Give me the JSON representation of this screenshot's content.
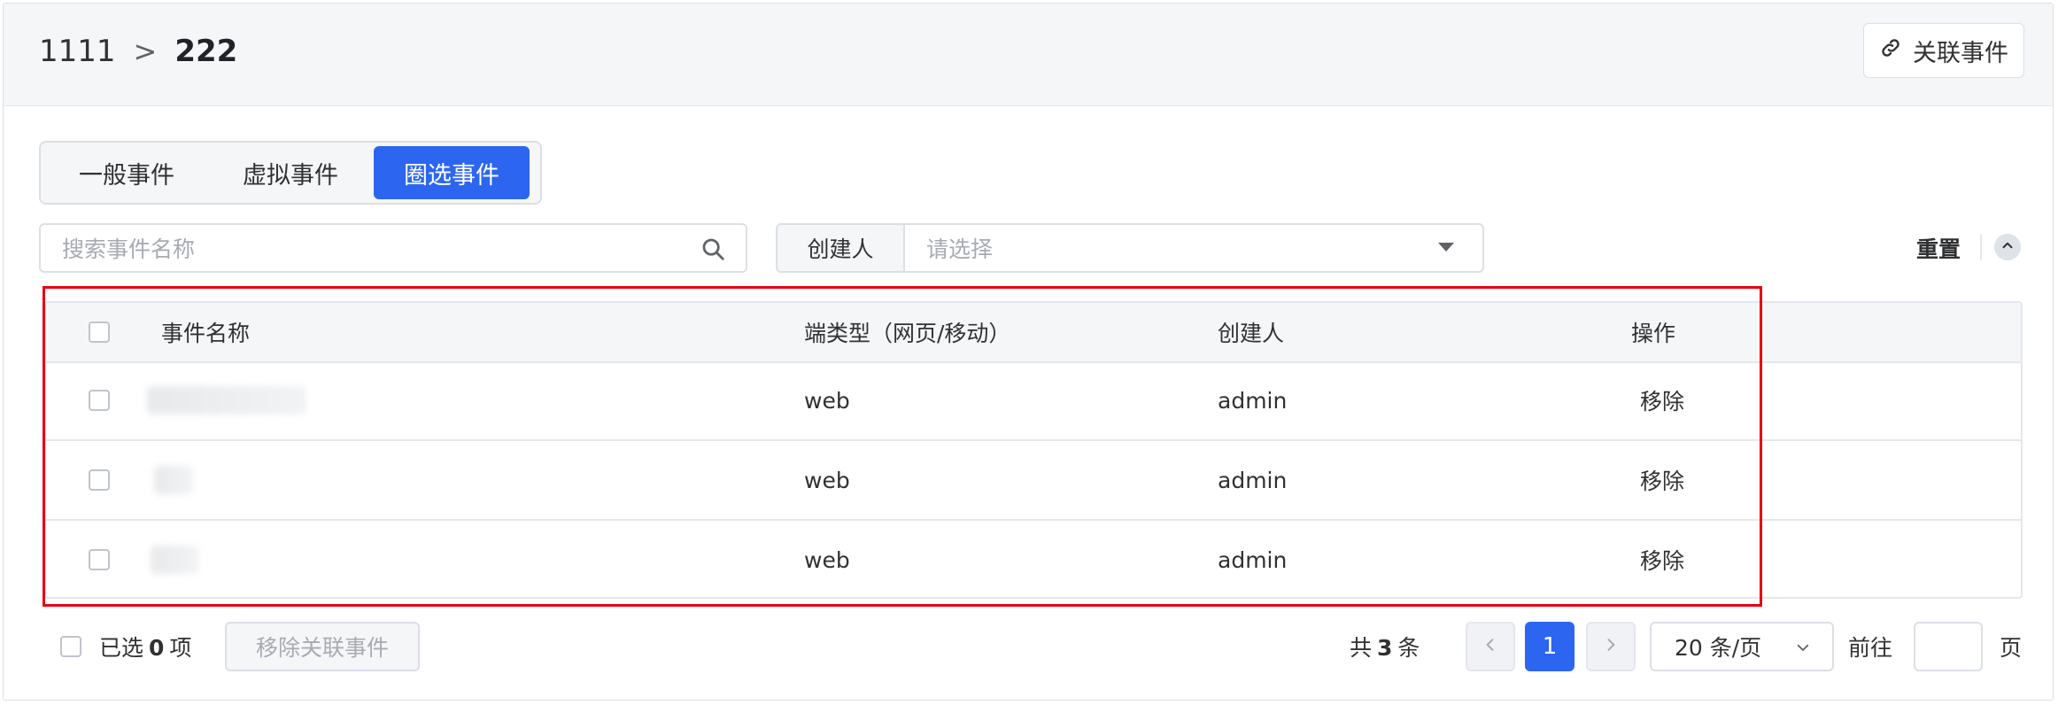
{
  "breadcrumb": {
    "parent": "1111",
    "separator": ">",
    "current": "222"
  },
  "header": {
    "link_event_button": "关联事件"
  },
  "tabs": [
    {
      "label": "一般事件",
      "active": false
    },
    {
      "label": "虚拟事件",
      "active": false
    },
    {
      "label": "圈选事件",
      "active": true
    }
  ],
  "search": {
    "placeholder": "搜索事件名称",
    "value": ""
  },
  "filter": {
    "label": "创建人",
    "placeholder": "请选择"
  },
  "toolbar": {
    "reset_label": "重置"
  },
  "table": {
    "columns": [
      "事件名称",
      "端类型（网页/移动）",
      "创建人",
      "操作"
    ],
    "rows": [
      {
        "name": "",
        "type": "web",
        "creator": "admin",
        "action": "移除"
      },
      {
        "name": "",
        "type": "web",
        "creator": "admin",
        "action": "移除"
      },
      {
        "name": "",
        "type": "web",
        "creator": "admin",
        "action": "移除"
      }
    ]
  },
  "footer": {
    "selected_prefix": "已选",
    "selected_count": "0",
    "selected_suffix": "项",
    "remove_linked_button": "移除关联事件",
    "total_prefix": "共",
    "total_count": "3",
    "total_suffix": "条",
    "current_page": "1",
    "page_size": "20 条/页",
    "goto_label": "前往",
    "goto_value": "",
    "goto_unit": "页"
  },
  "colors": {
    "primary": "#2c66f0",
    "highlight_border": "#e60012"
  }
}
